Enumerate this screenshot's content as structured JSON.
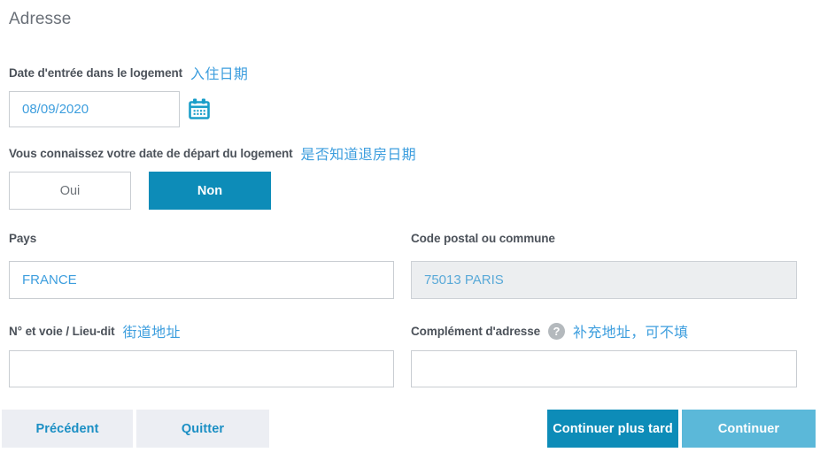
{
  "section": {
    "title": "Adresse"
  },
  "colors": {
    "accent_blue": "#0d8cb8",
    "accent_blue_light": "#5bb8d9",
    "link_blue": "#1b8fc4",
    "value_blue": "#3d9ede",
    "note_blue": "#3d9ede",
    "label_gray": "#4c525a",
    "title_gray": "#6a7078",
    "field_border": "#c9cdd2",
    "disabled_bg": "#eceef0",
    "button_secondary_bg": "#eceef3",
    "help_icon_gray": "#b4b9bd"
  },
  "fields": {
    "move_in_date": {
      "label": "Date d'entrée dans le logement",
      "note": "入住日期",
      "value": "08/09/2020",
      "placeholder": "JJ/MM/AAAA",
      "calendar_icon": "calendar-icon"
    },
    "departure_known": {
      "label": "Vous connaissez votre date de départ du logement",
      "note": "是否知道退房日期",
      "options": [
        {
          "label": "Oui",
          "selected": false
        },
        {
          "label": "Non",
          "selected": true
        }
      ]
    },
    "country": {
      "label": "Pays",
      "value": "FRANCE",
      "placeholder": "",
      "disabled": false
    },
    "postal_code": {
      "label": "Code postal ou commune",
      "value": "75013 PARIS",
      "placeholder": "",
      "disabled": true
    },
    "street": {
      "label": "N° et voie / Lieu-dit",
      "note": "街道地址",
      "value": "",
      "placeholder": ""
    },
    "address_complement": {
      "label": "Complément d'adresse",
      "note": "补充地址，可不填",
      "help_icon": "help-icon",
      "value": "",
      "placeholder": ""
    }
  },
  "footer": {
    "previous": "Précédent",
    "quit": "Quitter",
    "continue_later": "Continuer plus tard",
    "continue": "Continuer"
  }
}
